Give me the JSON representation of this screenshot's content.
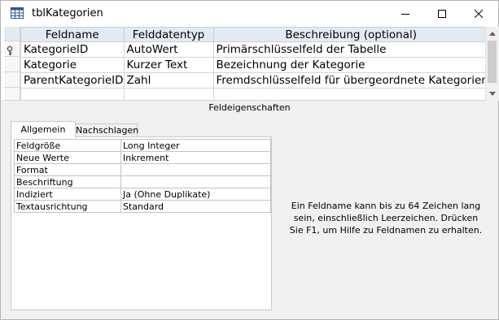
{
  "window": {
    "title": "tblKategorien",
    "icon": "table-icon",
    "controls": {
      "minimize": "minimize-icon",
      "maximize": "maximize-icon",
      "close": "close-icon"
    }
  },
  "field_grid": {
    "columns": [
      "Feldname",
      "Felddatentyp",
      "Beschreibung (optional)"
    ],
    "rows": [
      {
        "name": "KategorieID",
        "type": "AutoWert",
        "description": "Primärschlüsselfeld der Tabelle",
        "primary_key": true
      },
      {
        "name": "Kategorie",
        "type": "Kurzer Text",
        "description": "Bezeichnung der Kategorie",
        "primary_key": false
      },
      {
        "name": "ParentKategorieID",
        "type": "Zahl",
        "description": "Fremdschlüsselfeld für übergeordnete Kategorien",
        "primary_key": false
      },
      {
        "name": "",
        "type": "",
        "description": "",
        "primary_key": false
      }
    ]
  },
  "field_properties": {
    "heading": "Feldeigenschaften",
    "tabs": [
      "Allgemein",
      "Nachschlagen"
    ],
    "active_tab": "Allgemein",
    "rows": [
      {
        "label": "Feldgröße",
        "value": "Long Integer"
      },
      {
        "label": "Neue Werte",
        "value": "Inkrement"
      },
      {
        "label": "Format",
        "value": ""
      },
      {
        "label": "Beschriftung",
        "value": ""
      },
      {
        "label": "Indiziert",
        "value": "Ja (Ohne Duplikate)"
      },
      {
        "label": "Textausrichtung",
        "value": "Standard"
      }
    ],
    "help_text": "Ein Feldname kann bis zu 64 Zeichen lang sein, einschließlich Leerzeichen. Drücken Sie F1, um Hilfe zu Feldnamen zu erhalten."
  }
}
